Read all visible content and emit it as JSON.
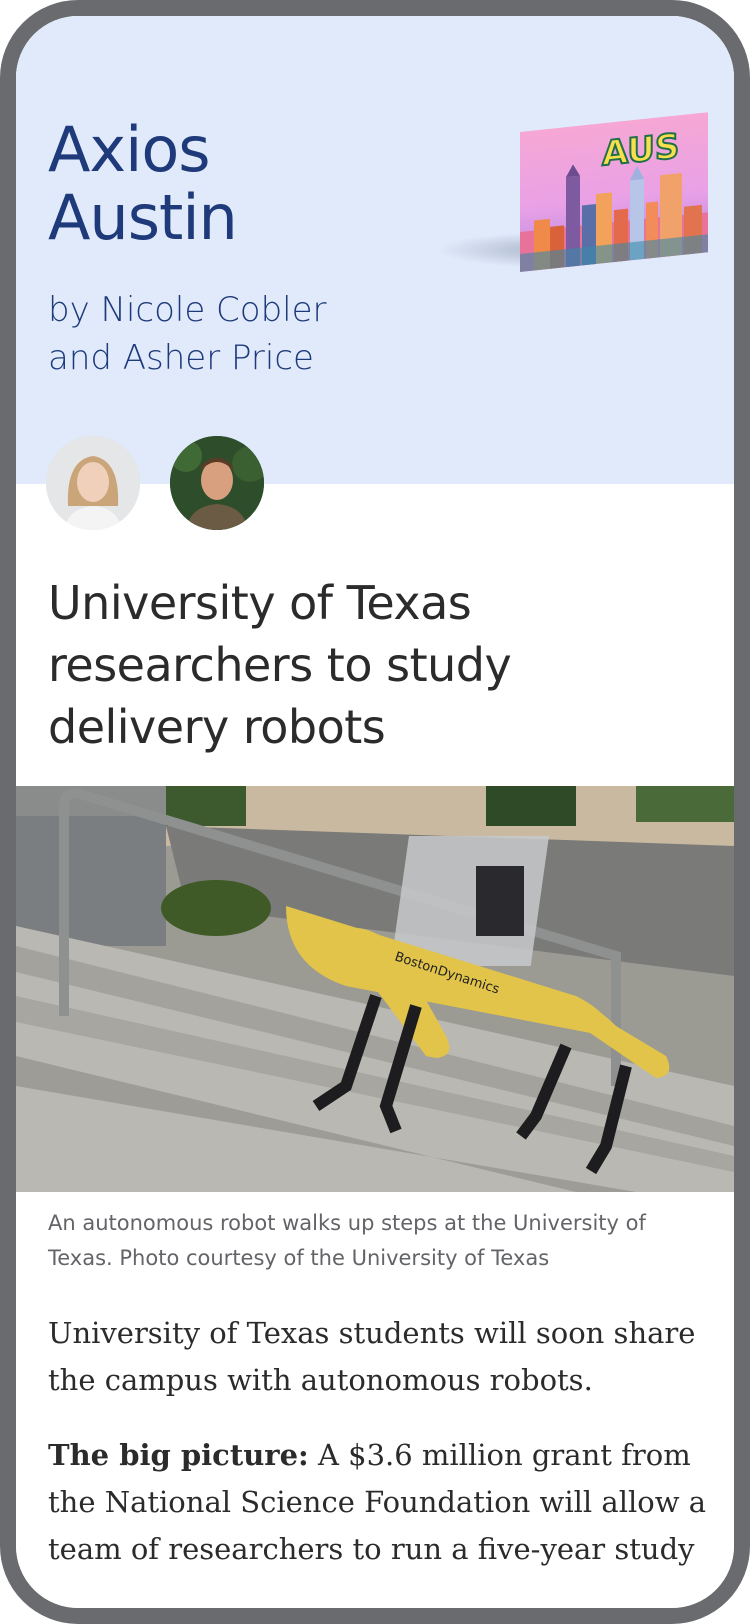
{
  "newsletter": {
    "title_line1": "Axios",
    "title_line2": "Austin",
    "byline_line1": "by Nicole Cobler",
    "byline_line2": "and Asher Price",
    "postcard_text": "AUS",
    "authors": [
      {
        "name": "Nicole Cobler"
      },
      {
        "name": "Asher Price"
      }
    ]
  },
  "article": {
    "headline": "University of Texas researchers to study delivery robots",
    "photo_brand_text": "BostonDynamics",
    "caption": "An autonomous robot walks up steps at the University of Texas. Photo courtesy of the University of Texas",
    "paragraph1": "University of Texas students will soon share the campus with autonomous robots.",
    "paragraph2_lead": "The big picture:",
    "paragraph2_text": " A $3.6 million grant from the National Science Foundation will allow a team of researchers to run a five-year study"
  },
  "colors": {
    "hero_bg": "#e0eafa",
    "brand_blue": "#1e3a7a",
    "frame": "#6a6b6e"
  }
}
